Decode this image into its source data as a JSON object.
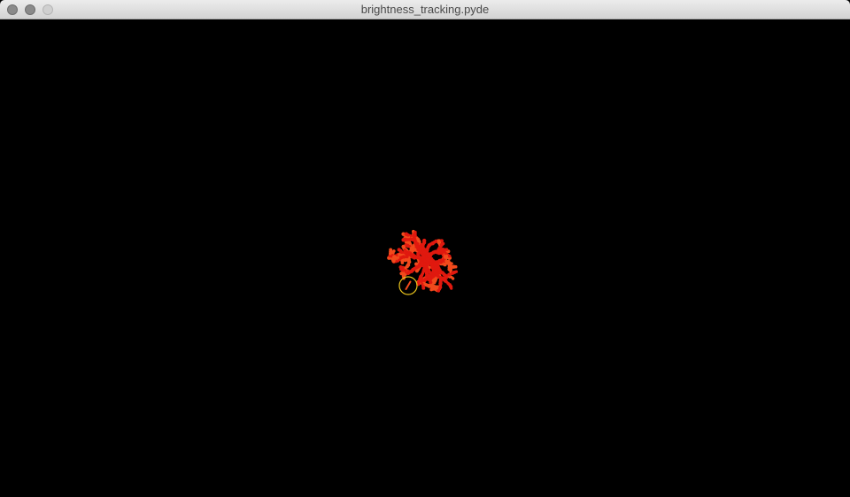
{
  "window": {
    "title": "brightness_tracking.pyde"
  },
  "sketch": {
    "background_color": "#000000",
    "cluster_color": "#e0190f",
    "cluster_edge_color": "#f24a1c",
    "tracker_color": "#e8c21c",
    "tracker_icon": "circle-outline"
  }
}
